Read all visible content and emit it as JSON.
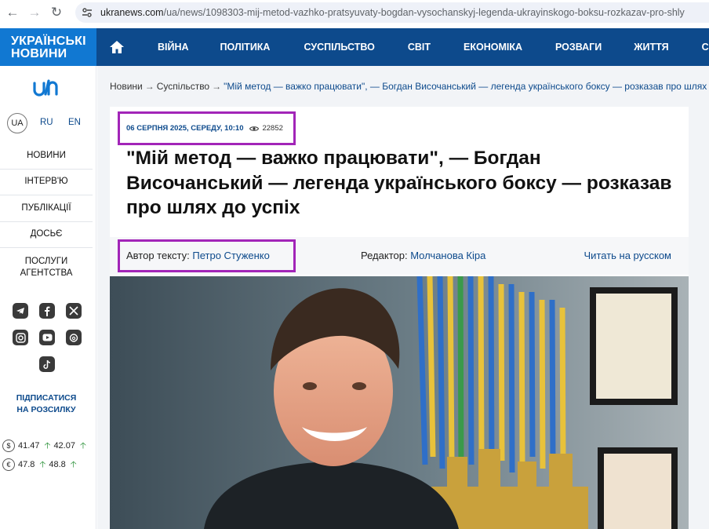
{
  "browser": {
    "url_domain": "ukranews.com",
    "url_path": "/ua/news/1098303-mij-metod-vazhko-pratsyuvaty-bogdan-vysochanskyj-legenda-ukrayinskogo-boksu-rozkazav-pro-shly"
  },
  "header": {
    "brand_line1": "УКРАЇНСЬКІ",
    "brand_line2": "НОВИНИ",
    "menu": [
      "ВІЙНА",
      "ПОЛІТИКА",
      "СУСПІЛЬСТВО",
      "СВІТ",
      "ЕКОНОМІКА",
      "РОЗВАГИ",
      "ЖИТТЯ",
      "СПОРТ"
    ]
  },
  "sidebar": {
    "languages": [
      "UA",
      "RU",
      "EN"
    ],
    "nav": [
      "НОВИНИ",
      "ІНТЕРВ'Ю",
      "ПУБЛІКАЦІЇ",
      "ДОСЬЄ",
      "ПОСЛУГИ АГЕНТСТВА"
    ],
    "social_icons": [
      "telegram-icon",
      "facebook-icon",
      "x-icon",
      "instagram-icon",
      "youtube-icon",
      "threads-icon",
      "tiktok-icon"
    ],
    "subscribe": "ПІДПИСАТИСЯ НА РОЗСИЛКУ",
    "rates": [
      {
        "symbol": "$",
        "buy": "41.47",
        "sell": "42.07"
      },
      {
        "symbol": "€",
        "buy": "47.8",
        "sell": "48.8"
      }
    ]
  },
  "breadcrumb": {
    "home": "Новини",
    "section": "Суспільство",
    "current": "\"Мій метод — важко працювати\", — Богдан Височанський — легенда українського боксу — розказав про шлях до успіх"
  },
  "article": {
    "date": "06 СЕРПНЯ 2025, СЕРЕДУ, 10:10",
    "views": "22852",
    "title": "\"Мій метод — важко працювати\", — Богдан Височанський — легенда українського боксу — розказав про шлях до успіх",
    "author_label": "Автор тексту:",
    "author_name": "Петро Стуженко",
    "editor_label": "Редактор:",
    "editor_name": "Молчанова Кіра",
    "read_ru": "Читать на русском"
  },
  "colors": {
    "header_bg": "#0d4a8c",
    "brand_bg": "#1178d2",
    "highlight": "#a225b8"
  }
}
